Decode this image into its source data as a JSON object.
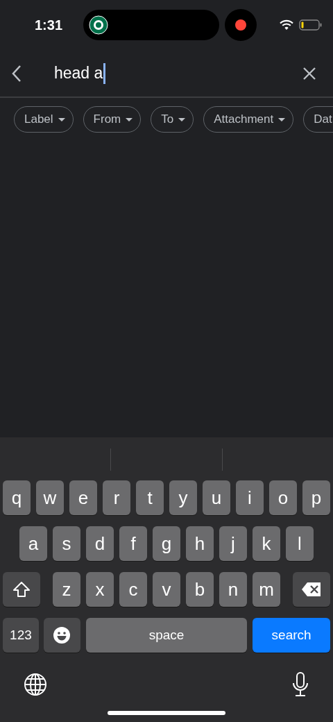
{
  "status_bar": {
    "time": "1:31",
    "recording": true
  },
  "search": {
    "value": "head a"
  },
  "filters": [
    {
      "label": "Label"
    },
    {
      "label": "From"
    },
    {
      "label": "To"
    },
    {
      "label": "Attachment"
    },
    {
      "label": "Dat"
    }
  ],
  "keyboard": {
    "rows": [
      {
        "keys": [
          {
            "kind": "letter",
            "label": "q"
          },
          {
            "kind": "letter",
            "label": "w"
          },
          {
            "kind": "letter",
            "label": "e"
          },
          {
            "kind": "letter",
            "label": "r"
          },
          {
            "kind": "letter",
            "label": "t"
          },
          {
            "kind": "letter",
            "label": "y"
          },
          {
            "kind": "letter",
            "label": "u"
          },
          {
            "kind": "letter",
            "label": "i"
          },
          {
            "kind": "letter",
            "label": "o"
          },
          {
            "kind": "letter",
            "label": "p"
          }
        ]
      },
      {
        "keys": [
          {
            "kind": "letter",
            "label": "a"
          },
          {
            "kind": "letter",
            "label": "s"
          },
          {
            "kind": "letter",
            "label": "d"
          },
          {
            "kind": "letter",
            "label": "f"
          },
          {
            "kind": "letter",
            "label": "g"
          },
          {
            "kind": "letter",
            "label": "h"
          },
          {
            "kind": "letter",
            "label": "j"
          },
          {
            "kind": "letter",
            "label": "k"
          },
          {
            "kind": "letter",
            "label": "l"
          }
        ]
      },
      {
        "keys": [
          {
            "kind": "shift"
          },
          {
            "kind": "letter",
            "label": "z"
          },
          {
            "kind": "letter",
            "label": "x"
          },
          {
            "kind": "letter",
            "label": "c"
          },
          {
            "kind": "letter",
            "label": "v"
          },
          {
            "kind": "letter",
            "label": "b"
          },
          {
            "kind": "letter",
            "label": "n"
          },
          {
            "kind": "letter",
            "label": "m"
          },
          {
            "kind": "delete"
          }
        ]
      },
      {
        "keys": [
          {
            "kind": "mode",
            "label": "123"
          },
          {
            "kind": "emoji"
          },
          {
            "kind": "space",
            "label": "space"
          },
          {
            "kind": "action",
            "label": "search"
          }
        ]
      }
    ]
  }
}
